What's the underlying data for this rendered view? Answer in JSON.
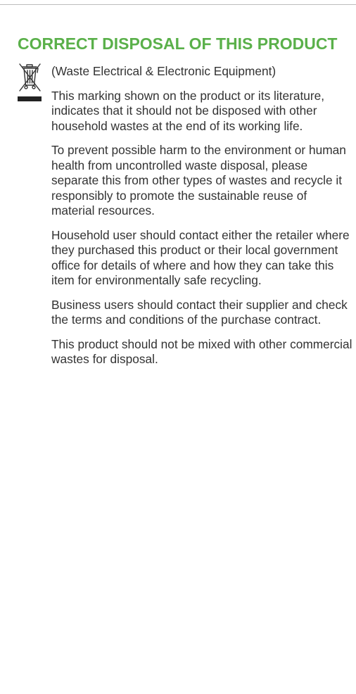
{
  "page": {
    "heading": "CORRECT DISPOSAL OF THIS PRODUCT",
    "icon": "crossed-out-wheelie-bin-icon",
    "colors": {
      "heading": "#5ab04a",
      "text": "#333333",
      "rule": "#bdbdbd"
    },
    "subtitle": "(Waste Electrical & Electronic Equipment)",
    "paragraphs": [
      "This marking shown on the product or its literature, indicates that it should not be disposed with other household wastes at the end of its working life.",
      "To prevent possible harm to the environment or human health from uncontrolled waste disposal, please separate this from other types of wastes and recycle it responsibly to promote the sustainable reuse of material resources.",
      "Household user should contact either the retailer where they purchased this product or their local government office for details of where and how they can take this item for environmentally safe recycling.",
      "Business users should contact their supplier and check the terms and conditions of the purchase contract.",
      "This product should not be mixed with other commercial wastes for disposal."
    ]
  }
}
